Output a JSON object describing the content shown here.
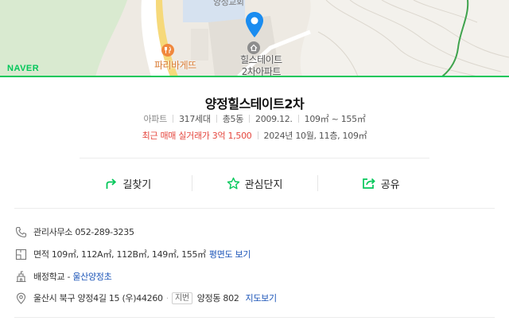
{
  "map": {
    "labels": {
      "top_partial": "양정교회",
      "shop": "파리바게뜨",
      "apartment_line1": "힐스테이트",
      "apartment_line2": "2차아파트"
    },
    "logo": "NAVER",
    "colors": {
      "brand": "#03c75a",
      "marker": "#1a8cf0",
      "shop": "#d8782f"
    }
  },
  "complex": {
    "name": "양정힐스테이트2차",
    "type": "아파트",
    "households": "317세대",
    "buildings": "총5동",
    "approval": "2009.12.",
    "area_range": "109㎡ ~ 155㎡",
    "recent_trade_label": "최근 매매 실거래가",
    "recent_trade_price": "3억 1,500",
    "recent_trade_detail": "2024년 10월, 11층, 109㎡"
  },
  "actions": {
    "directions": "길찾기",
    "favorite": "관심단지",
    "share": "공유"
  },
  "info": {
    "office_label": "관리사무소",
    "office_phone": "052-289-3235",
    "area_label": "면적",
    "area_values": "109㎡, 112A㎡, 112B㎡, 149㎡, 155㎡",
    "floorplan_link": "평면도 보기",
    "school_label": "배정학교",
    "school_name": "울산양정초",
    "address": "울산시 북구 양정4길 15 (우)44260",
    "lot_tag": "지번",
    "lot_address": "양정동 802",
    "map_link": "지도보기"
  }
}
